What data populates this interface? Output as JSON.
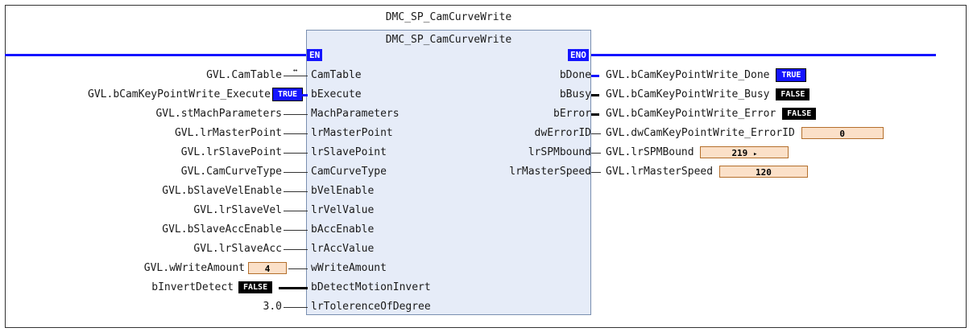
{
  "block": {
    "instance_name": "DMC_SP_CamCurveWrite",
    "type_name": "DMC_SP_CamCurveWrite",
    "en": "EN",
    "eno": "ENO"
  },
  "inputs": [
    {
      "var": "GVL.CamTable",
      "pin": "CamTable"
    },
    {
      "var": "GVL.bCamKeyPointWrite_Execute",
      "pin": "bExecute",
      "value": "TRUE"
    },
    {
      "var": "GVL.stMachParameters",
      "pin": "MachParameters"
    },
    {
      "var": "GVL.lrMasterPoint",
      "pin": "lrMasterPoint"
    },
    {
      "var": "GVL.lrSlavePoint",
      "pin": "lrSlavePoint"
    },
    {
      "var": "GVL.CamCurveType",
      "pin": "CamCurveType"
    },
    {
      "var": "GVL.bSlaveVelEnable",
      "pin": "bVelEnable"
    },
    {
      "var": "GVL.lrSlaveVel",
      "pin": "lrVelValue"
    },
    {
      "var": "GVL.bSlaveAccEnable",
      "pin": "bAccEnable"
    },
    {
      "var": "GVL.lrSlaveAcc",
      "pin": "lrAccValue"
    },
    {
      "var": "GVL.wWriteAmount",
      "pin": "wWriteAmount",
      "value": "4"
    },
    {
      "var": "bInvertDetect",
      "pin": "bDetectMotionInvert",
      "value": "FALSE"
    },
    {
      "var": "3.0",
      "pin": "lrTolerenceOfDegree"
    }
  ],
  "outputs": [
    {
      "pin": "bDone",
      "var": "GVL.bCamKeyPointWrite_Done",
      "value": "TRUE"
    },
    {
      "pin": "bBusy",
      "var": "GVL.bCamKeyPointWrite_Busy",
      "value": "FALSE"
    },
    {
      "pin": "bError",
      "var": "GVL.bCamKeyPointWrite_Error",
      "value": "FALSE"
    },
    {
      "pin": "dwErrorID",
      "var": "GVL.dwCamKeyPointWrite_ErrorID",
      "value": "0"
    },
    {
      "pin": "lrSPMbound",
      "var": "GVL.lrSPMBound",
      "value": "219",
      "arrow": "▸"
    },
    {
      "pin": "lrMasterSpeed",
      "var": "GVL.lrMasterSpeed",
      "value": "120"
    }
  ],
  "colors": {
    "signal_true": "#1414ff",
    "signal_false": "#000000",
    "numeric_bg": "#fbe0c8",
    "block_fill": "#e6ecf8"
  }
}
